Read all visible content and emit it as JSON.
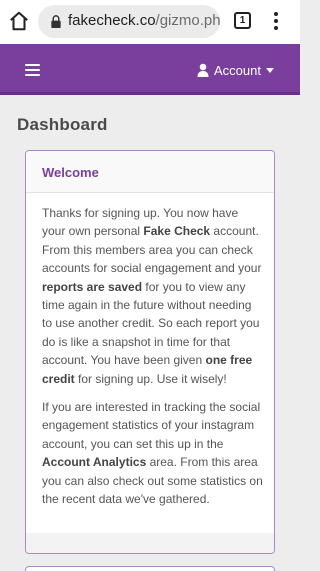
{
  "browser": {
    "url_domain": "fakecheck.co",
    "url_path": "/gizmo.php",
    "tab_count": "1"
  },
  "navbar": {
    "account_label": "Account"
  },
  "main": {
    "page_title": "Dashboard",
    "welcome_card": {
      "title": "Welcome",
      "p1_a": "Thanks for signing up. You now have your own personal ",
      "p1_b": "Fake Check",
      "p1_c": " account. From this members area you can check accounts for social engagement and your ",
      "p1_d": "reports are saved",
      "p1_e": " for you to view any time again in the future without needing to use another credit. So each report you do is like a snapshot in time for that account. You have been given ",
      "p1_f": "one free credit",
      "p1_g": " for signing up. Use it wisely!",
      "p2_a": "If you are interested in tracking the social engagement statistics of your instagram account, you can set this up in the ",
      "p2_b": "Account Analytics",
      "p2_c": " area. From this area you can also check out some statistics on the recent data we've gathered."
    }
  },
  "colors": {
    "brand_purple": "#7a3e9d",
    "card_border": "#a789c4",
    "page_bg": "#ededed"
  }
}
